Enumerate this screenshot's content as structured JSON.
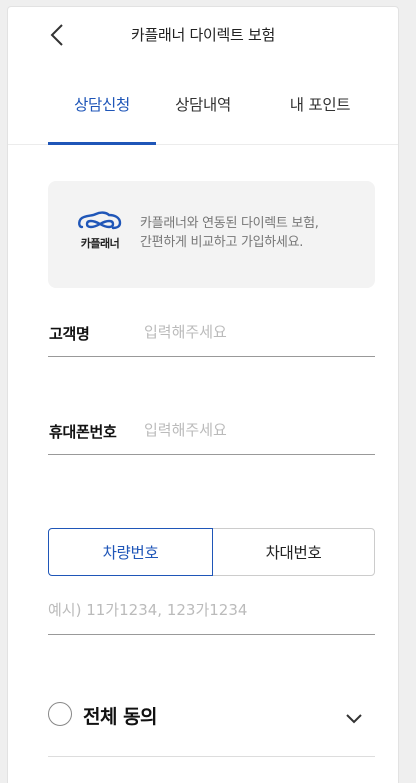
{
  "header": {
    "title": "카플래너 다이렉트 보험",
    "back_icon": "chevron-left-icon"
  },
  "tabs": [
    {
      "label": "상담신청",
      "active": true
    },
    {
      "label": "상담내역",
      "active": false
    },
    {
      "label": "내 포인트",
      "active": false
    }
  ],
  "promo": {
    "logo_icon": "infinity-car-logo",
    "logo_text": "카플래너",
    "line1": "카플래너와 연동된 다이렉트 보험,",
    "line2": "간편하게 비교하고 가입하세요."
  },
  "form": {
    "name": {
      "label": "고객명",
      "placeholder": "입력해주세요",
      "value": ""
    },
    "phone": {
      "label": "휴대폰번호",
      "placeholder": "입력해주세요",
      "value": ""
    },
    "vehicle_toggle": {
      "options": [
        "차량번호",
        "차대번호"
      ],
      "selected": "차량번호"
    },
    "plate": {
      "placeholder": "예시) 11가1234, 123가1234",
      "value": ""
    }
  },
  "agreement": {
    "label": "전체 동의",
    "checked": false,
    "expand_icon": "chevron-down-icon"
  },
  "colors": {
    "accent": "#1f56b8",
    "promo_bg": "#f3f3f3"
  }
}
